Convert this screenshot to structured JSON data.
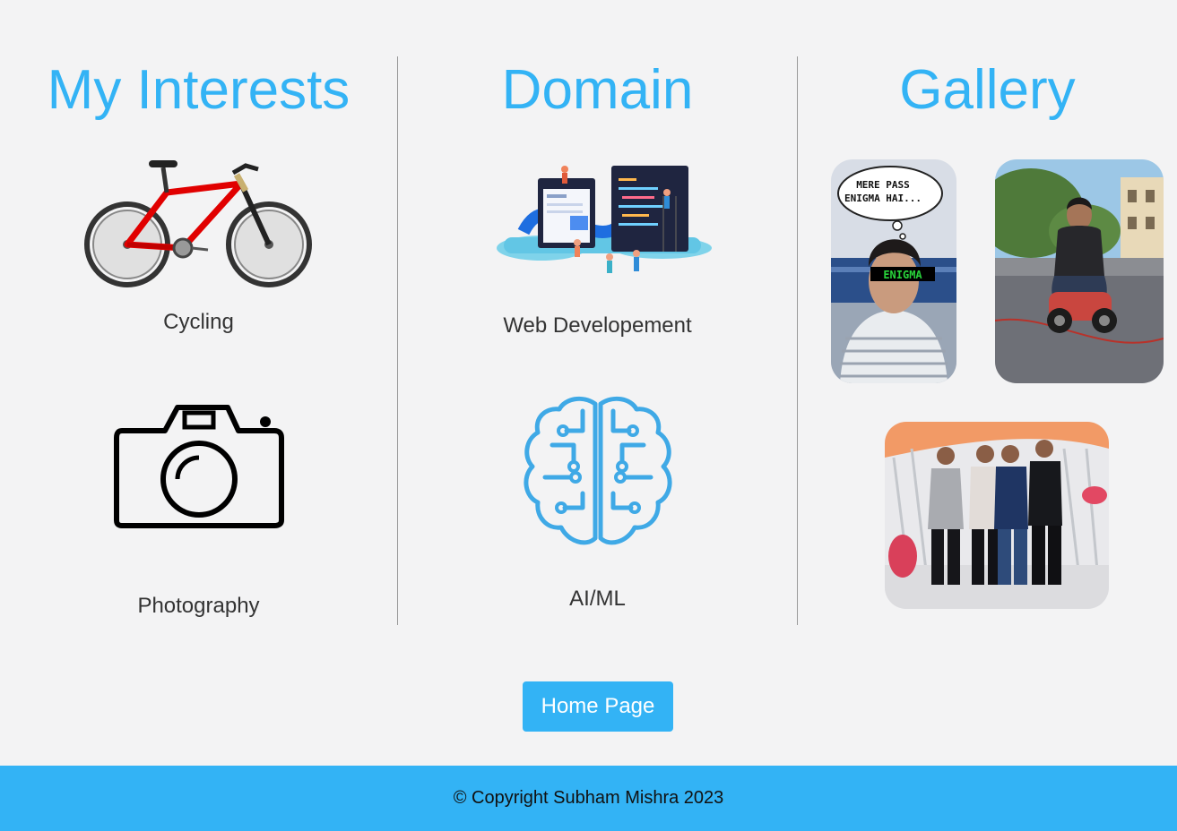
{
  "interests": {
    "title": "My Interests",
    "items": [
      {
        "label": "Cycling",
        "icon": "bicycle-icon"
      },
      {
        "label": "Photography",
        "icon": "camera-icon"
      }
    ]
  },
  "domain": {
    "title": "Domain",
    "items": [
      {
        "label": "Web Developement",
        "icon": "web-development-illustration"
      },
      {
        "label": "AI/ML",
        "icon": "brain-circuit-icon"
      }
    ]
  },
  "gallery": {
    "title": "Gallery",
    "photos": [
      {
        "caption_line1": "MERE PASS",
        "caption_line2": "ENIGMA HAI...",
        "glasses_text": "ENIGMA"
      },
      {},
      {}
    ]
  },
  "home_button": {
    "label": "Home Page"
  },
  "footer": {
    "text": "© Copyright Subham Mishra 2023"
  },
  "colors": {
    "accent": "#33b3f5",
    "background": "#f3f3f4"
  }
}
